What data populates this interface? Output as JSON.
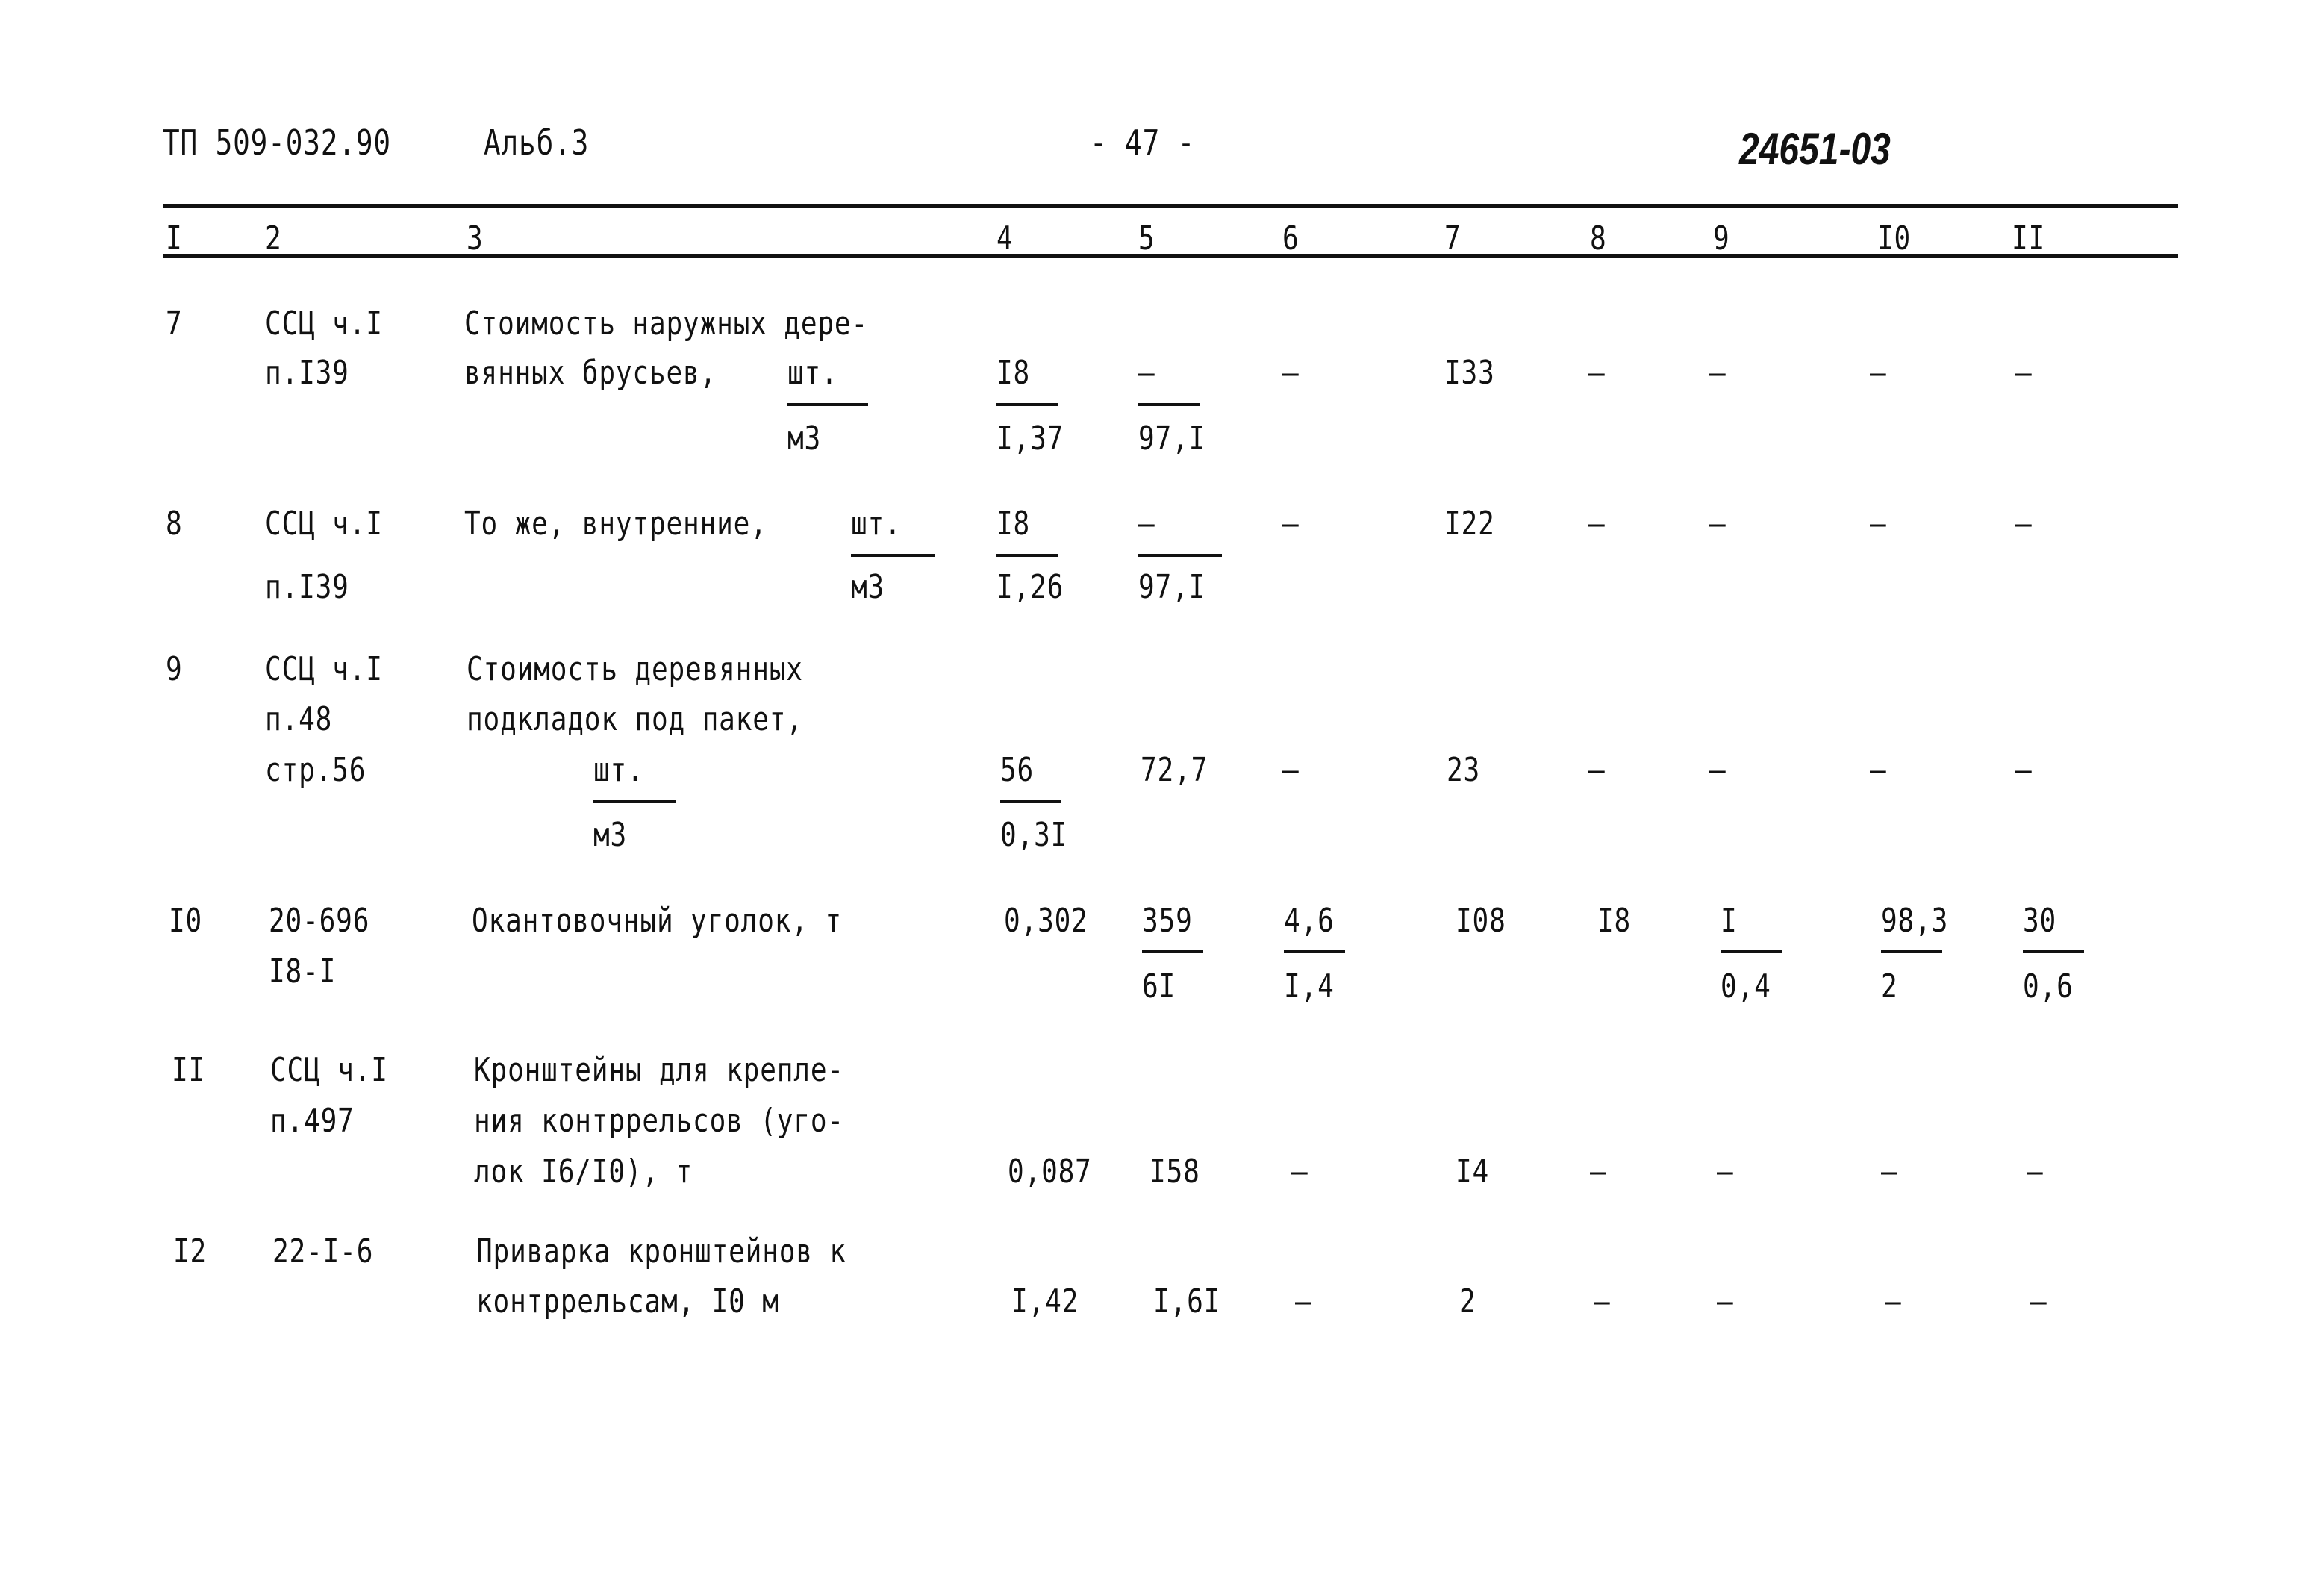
{
  "header": {
    "doc_code": "ТП 509-032.90",
    "album": "Альб.3",
    "page_number": "- 47 -",
    "stamp": "24651-03"
  },
  "columns": [
    "I",
    "2",
    "3",
    "4",
    "5",
    "6",
    "7",
    "8",
    "9",
    "I0",
    "II"
  ],
  "rows": [
    {
      "num": "7",
      "ref": [
        "ССЦ ч.I",
        "п.I39"
      ],
      "desc": [
        "Стоимость наружных дере-",
        "вянных брусьев,"
      ],
      "unit_top": "шт.",
      "unit_bottom": "м3",
      "c4": {
        "top": "I8",
        "bottom": "I,37"
      },
      "c5": {
        "top": "–",
        "bottom": "97,I"
      },
      "c6": "–",
      "c7": "I33",
      "c8": "–",
      "c9": "–",
      "c10": "–",
      "c11": "–"
    },
    {
      "num": "8",
      "ref": [
        "ССЦ ч.I",
        "п.I39"
      ],
      "desc": [
        "То же, внутренние,"
      ],
      "unit_top": "шт.",
      "unit_bottom": "м3",
      "c4": {
        "top": "I8",
        "bottom": "I,26"
      },
      "c5": {
        "top": "–",
        "bottom": "97,I"
      },
      "c6": "–",
      "c7": "I22",
      "c8": "–",
      "c9": "–",
      "c10": "–",
      "c11": "–"
    },
    {
      "num": "9",
      "ref": [
        "ССЦ ч.I",
        "п.48",
        "стр.56"
      ],
      "desc": [
        "Стоимость деревянных",
        "подкладок под пакет,"
      ],
      "unit_top": "шт.",
      "unit_bottom": "м3",
      "c4": {
        "top": "56",
        "bottom": "0,3I"
      },
      "c5": "72,7",
      "c6": "–",
      "c7": "23",
      "c8": "–",
      "c9": "–",
      "c10": "–",
      "c11": "–"
    },
    {
      "num": "I0",
      "ref": [
        "20-696",
        "I8-I"
      ],
      "desc": [
        "Окантовочный уголок, т"
      ],
      "c4": "0,302",
      "c5": {
        "top": "359",
        "bottom": "6I"
      },
      "c6": {
        "top": "4,6",
        "bottom": "I,4"
      },
      "c7": "I08",
      "c8": "I8",
      "c9": {
        "top": "I",
        "bottom": "0,4"
      },
      "c10": {
        "top": "98,3",
        "bottom": "2"
      },
      "c11": {
        "top": "30",
        "bottom": "0,6"
      }
    },
    {
      "num": "II",
      "ref": [
        "ССЦ ч.I",
        "п.497"
      ],
      "desc": [
        "Кронштейны для крепле-",
        "ния контррельсов (уго-",
        "лок I6/I0), т"
      ],
      "c4": "0,087",
      "c5": "I58",
      "c6": "–",
      "c7": "I4",
      "c8": "–",
      "c9": "–",
      "c10": "–",
      "c11": "–"
    },
    {
      "num": "I2",
      "ref": [
        "22-I-6"
      ],
      "desc": [
        "Приварка кронштейнов к",
        "контррельсам, I0 м"
      ],
      "c4": "I,42",
      "c5": "I,6I",
      "c6": "–",
      "c7": "2",
      "c8": "–",
      "c9": "–",
      "c10": "–",
      "c11": "–"
    }
  ]
}
